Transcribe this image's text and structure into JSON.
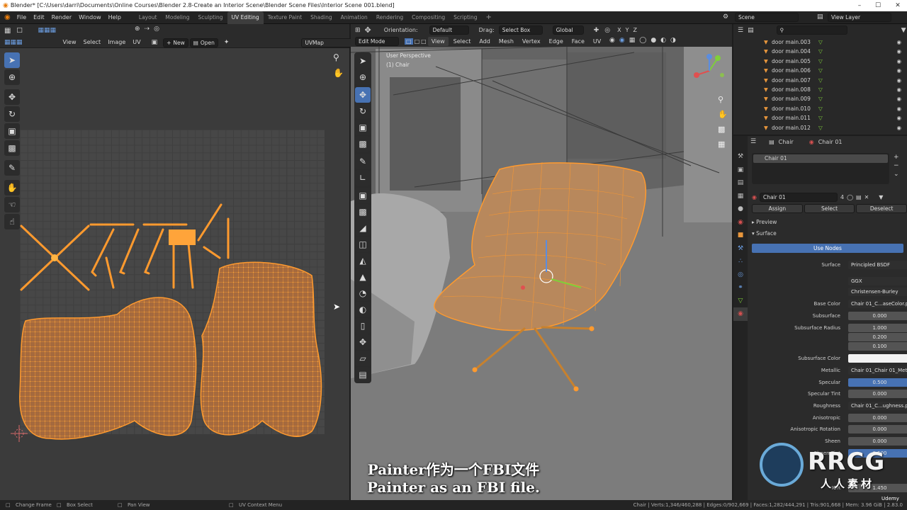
{
  "titlebar": {
    "title": "Blender* [C:\\Users\\darri\\Documents\\Online Courses\\Blender 2.8-Create an Interior Scene\\Blender Scene Files\\Interior Scene 001.blend]",
    "minimize": "–",
    "maximize": "☐",
    "close": "✕"
  },
  "menu": {
    "items": [
      "File",
      "Edit",
      "Render",
      "Window",
      "Help"
    ],
    "workspaces": [
      "Layout",
      "Modeling",
      "Sculpting",
      "UV Editing",
      "Texture Paint",
      "Shading",
      "Animation",
      "Rendering",
      "Compositing",
      "Scripting"
    ],
    "active_workspace": "UV Editing",
    "add_workspace": "+",
    "scene": "Scene",
    "view_layer": "View Layer"
  },
  "uv_editor": {
    "menus": [
      "View",
      "Select",
      "Image",
      "UV"
    ],
    "new_label": "New",
    "open_label": "Open",
    "uvmap": "UVMap"
  },
  "viewport": {
    "mode": "Edit Mode",
    "menus": [
      "View",
      "Select",
      "Add",
      "Mesh",
      "Vertex",
      "Edge",
      "Face",
      "UV"
    ],
    "orientation_label": "Orientation:",
    "orientation": "Default",
    "drag_label": "Drag:",
    "drag": "Select Box",
    "transform": "Global",
    "perspective": "User Perspective",
    "object": "(1) Chair",
    "axes": {
      "x": "X",
      "y": "Y",
      "z": "Z"
    }
  },
  "outliner": {
    "search_placeholder": "",
    "rows": [
      "door main.003",
      "door main.004",
      "door main.005",
      "door main.006",
      "door main.007",
      "door main.008",
      "door main.009",
      "door main.010",
      "door main.011",
      "door main.012"
    ]
  },
  "properties": {
    "breadcrumb_object": "Chair",
    "breadcrumb_material": "Chair 01",
    "slot": "Chair 01",
    "material_name": "Chair 01",
    "users": "4",
    "assign": "Assign",
    "select": "Select",
    "deselect": "Deselect",
    "preview": "Preview",
    "surface_panel": "Surface",
    "use_nodes": "Use Nodes",
    "rows": [
      {
        "label": "Surface",
        "value": "Principled BSDF",
        "kind": "node"
      },
      {
        "label": "",
        "value": "GGX",
        "kind": "node"
      },
      {
        "label": "",
        "value": "Christensen-Burley",
        "kind": "node"
      },
      {
        "label": "Base Color",
        "value": "Chair 01_C...aseColor.png",
        "kind": "node"
      },
      {
        "label": "Subsurface",
        "value": "0.000",
        "kind": "num"
      },
      {
        "label": "Subsurface Radius",
        "value": "1.000",
        "kind": "num"
      },
      {
        "label": "",
        "value": "0.200",
        "kind": "num"
      },
      {
        "label": "",
        "value": "0.100",
        "kind": "num"
      },
      {
        "label": "Subsurface Color",
        "value": "",
        "kind": "white"
      },
      {
        "label": "Metallic",
        "value": "Chair 01_Chair 01_Meta...",
        "kind": "node"
      },
      {
        "label": "Specular",
        "value": "0.500",
        "kind": "blue"
      },
      {
        "label": "Specular Tint",
        "value": "0.000",
        "kind": "num"
      },
      {
        "label": "Roughness",
        "value": "Chair 01_C...ughness.png",
        "kind": "node"
      },
      {
        "label": "Anisotropic",
        "value": "0.000",
        "kind": "num"
      },
      {
        "label": "Anisotropic Rotation",
        "value": "0.000",
        "kind": "num"
      },
      {
        "label": "Sheen",
        "value": "0.000",
        "kind": "num"
      },
      {
        "label": "Sheen Tint",
        "value": "0.500",
        "kind": "blue"
      },
      {
        "label": "IOR",
        "value": "1.450",
        "kind": "num"
      }
    ]
  },
  "status": {
    "change_frame": "Change Frame",
    "box_select": "Box Select",
    "pan_view": "Pan View",
    "uv_context": "UV Context Menu",
    "stats": "Chair | Verts:1,346/460,288 | Edges:0/902,669 | Faces:1,282/444,291 | Tris:901,668 | Mem: 3.96 GiB | 2.83.0"
  },
  "subtitles": {
    "line_cn": "Painter作为一个FBI文件",
    "line_en": "Painter as an FBI file."
  },
  "watermark": {
    "brand": "RRCG",
    "sub": "人人素材",
    "udemy": "Udemy"
  },
  "colors": {
    "accent": "#4772b3",
    "selection": "#ff9a2e",
    "uv_fill": "#a56a3e"
  }
}
